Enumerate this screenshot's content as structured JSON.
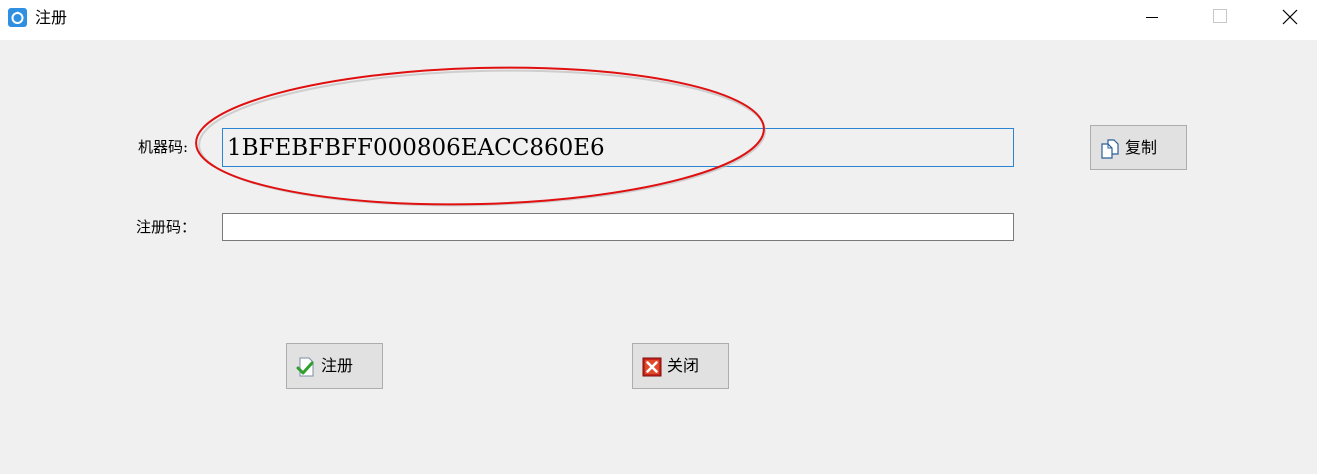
{
  "window": {
    "title": "注册",
    "icon": "app-logo-icon",
    "controls": [
      "minimize-icon",
      "maximize-icon",
      "close-icon"
    ]
  },
  "form": {
    "machine_code_label": "机器码:",
    "machine_code_value": "1BFEBFBFF000806EACC860E6",
    "registration_code_label": "注册码：",
    "registration_code_value": ""
  },
  "buttons": {
    "copy": "复制",
    "register": "注册",
    "close": "关闭"
  },
  "colors": {
    "annotation_circle": "#e01010",
    "focus_border": "#2a86d4",
    "app_icon": "#2f8fe0"
  }
}
